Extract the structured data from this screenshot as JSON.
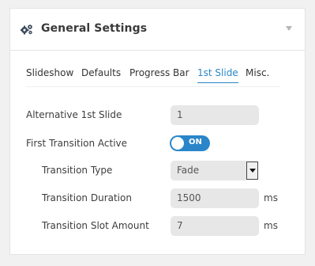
{
  "panel": {
    "title": "General Settings",
    "icon": "gears-icon",
    "collapse_icon": "caret-down-icon"
  },
  "tabs": [
    {
      "label": "Slideshow",
      "active": false
    },
    {
      "label": "Defaults",
      "active": false
    },
    {
      "label": "Progress Bar",
      "active": false
    },
    {
      "label": "1st Slide",
      "active": true
    },
    {
      "label": "Misc.",
      "active": false
    }
  ],
  "settings": {
    "alternative_first_slide": {
      "label": "Alternative 1st Slide",
      "value": "1"
    },
    "first_transition_active": {
      "label": "First Transition Active",
      "state": "ON"
    },
    "transition_type": {
      "label": "Transition Type",
      "value": "Fade"
    },
    "transition_duration": {
      "label": "Transition Duration",
      "value": "1500",
      "unit": "ms"
    },
    "transition_slot_amount": {
      "label": "Transition Slot Amount",
      "value": "7",
      "unit": "ms"
    }
  },
  "colors": {
    "accent": "#2a86c9",
    "field_bg": "#e7e7e7",
    "page_bg": "#f1f1f1"
  }
}
